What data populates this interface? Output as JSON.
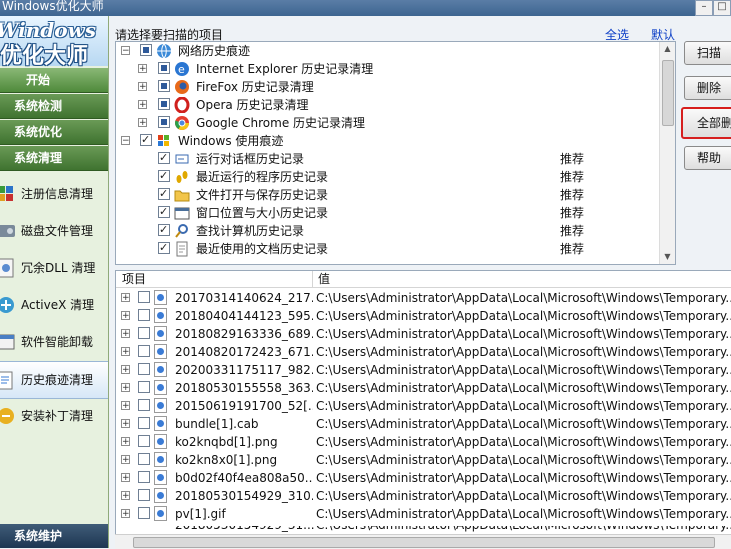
{
  "window": {
    "title": "Windows优化大师"
  },
  "sidebar": {
    "logo_line1": "Windows",
    "logo_line2": "优化大师",
    "categories": [
      {
        "label": "开始"
      },
      {
        "label": "系统检测"
      },
      {
        "label": "系统优化"
      },
      {
        "label": "系统清理"
      }
    ],
    "items": [
      {
        "label": "注册信息清理",
        "icon": "registry-icon"
      },
      {
        "label": "磁盘文件管理",
        "icon": "disk-icon"
      },
      {
        "label": "冗余DLL 清理",
        "icon": "dll-icon"
      },
      {
        "label": "ActiveX 清理",
        "icon": "activex-icon"
      },
      {
        "label": "软件智能卸载",
        "icon": "uninstall-icon"
      },
      {
        "label": "历史痕迹清理",
        "icon": "history-icon",
        "active": true
      },
      {
        "label": "安装补丁清理",
        "icon": "patch-icon"
      }
    ],
    "bottom_category": "系统维护"
  },
  "scan_panel": {
    "label": "请选择要扫描的项目",
    "select_all": "全选",
    "default": "默认",
    "tree": [
      {
        "text": "网络历史痕迹",
        "level": 0,
        "expander": "-",
        "check": "part",
        "icon": "globe-icon"
      },
      {
        "text": "Internet Explorer 历史记录清理",
        "level": 1,
        "expander": "+",
        "check": "part",
        "icon": "ie-icon"
      },
      {
        "text": "FireFox 历史记录清理",
        "level": 1,
        "expander": "+",
        "check": "part",
        "icon": "firefox-icon"
      },
      {
        "text": "Opera 历史记录清理",
        "level": 1,
        "expander": "+",
        "check": "part",
        "icon": "opera-icon"
      },
      {
        "text": "Google Chrome 历史记录清理",
        "level": 1,
        "expander": "+",
        "check": "part",
        "icon": "chrome-icon"
      },
      {
        "text": "Windows 使用痕迹",
        "level": 0,
        "expander": "-",
        "check": "on",
        "icon": "windows-flag-icon"
      },
      {
        "text": "运行对话框历史记录",
        "level": 2,
        "check": "on",
        "icon": "run-icon",
        "rec": "推荐"
      },
      {
        "text": "最近运行的程序历史记录",
        "level": 2,
        "check": "on",
        "icon": "footprint-icon",
        "rec": "推荐"
      },
      {
        "text": "文件打开与保存历史记录",
        "level": 2,
        "check": "on",
        "icon": "folder-icon",
        "rec": "推荐"
      },
      {
        "text": "窗口位置与大小历史记录",
        "level": 2,
        "check": "on",
        "icon": "window-icon",
        "rec": "推荐"
      },
      {
        "text": "查找计算机历史记录",
        "level": 2,
        "check": "on",
        "icon": "search-icon",
        "rec": "推荐"
      },
      {
        "text": "最近使用的文档历史记录",
        "level": 2,
        "check": "on",
        "icon": "document-icon",
        "rec": "推荐"
      }
    ]
  },
  "buttons": {
    "scan": "扫描",
    "delete": "删除",
    "delete_all": "全部删除",
    "help": "帮助"
  },
  "results": {
    "columns": [
      "项目",
      "值"
    ],
    "rows": [
      {
        "name": "20170314140624_217...",
        "value": "C:\\Users\\Administrator\\AppData\\Local\\Microsoft\\Windows\\Temporary..."
      },
      {
        "name": "20180404144123_595...",
        "value": "C:\\Users\\Administrator\\AppData\\Local\\Microsoft\\Windows\\Temporary..."
      },
      {
        "name": "20180829163336_689...",
        "value": "C:\\Users\\Administrator\\AppData\\Local\\Microsoft\\Windows\\Temporary..."
      },
      {
        "name": "20140820172423_671...",
        "value": "C:\\Users\\Administrator\\AppData\\Local\\Microsoft\\Windows\\Temporary..."
      },
      {
        "name": "20200331175117_982...",
        "value": "C:\\Users\\Administrator\\AppData\\Local\\Microsoft\\Windows\\Temporary..."
      },
      {
        "name": "20180530155558_363...",
        "value": "C:\\Users\\Administrator\\AppData\\Local\\Microsoft\\Windows\\Temporary..."
      },
      {
        "name": "20150619191700_52[...",
        "value": "C:\\Users\\Administrator\\AppData\\Local\\Microsoft\\Windows\\Temporary..."
      },
      {
        "name": "bundle[1].cab",
        "value": "C:\\Users\\Administrator\\AppData\\Local\\Microsoft\\Windows\\Temporary..."
      },
      {
        "name": "ko2knqbd[1].png",
        "value": "C:\\Users\\Administrator\\AppData\\Local\\Microsoft\\Windows\\Temporary..."
      },
      {
        "name": "ko2kn8x0[1].png",
        "value": "C:\\Users\\Administrator\\AppData\\Local\\Microsoft\\Windows\\Temporary..."
      },
      {
        "name": "b0d02f40f4ea808a50...",
        "value": "C:\\Users\\Administrator\\AppData\\Local\\Microsoft\\Windows\\Temporary..."
      },
      {
        "name": "20180530154929_310...",
        "value": "C:\\Users\\Administrator\\AppData\\Local\\Microsoft\\Windows\\Temporary..."
      },
      {
        "name": "pv[1].gif",
        "value": "C:\\Users\\Administrator\\AppData\\Local\\Microsoft\\Windows\\Temporary..."
      }
    ]
  }
}
